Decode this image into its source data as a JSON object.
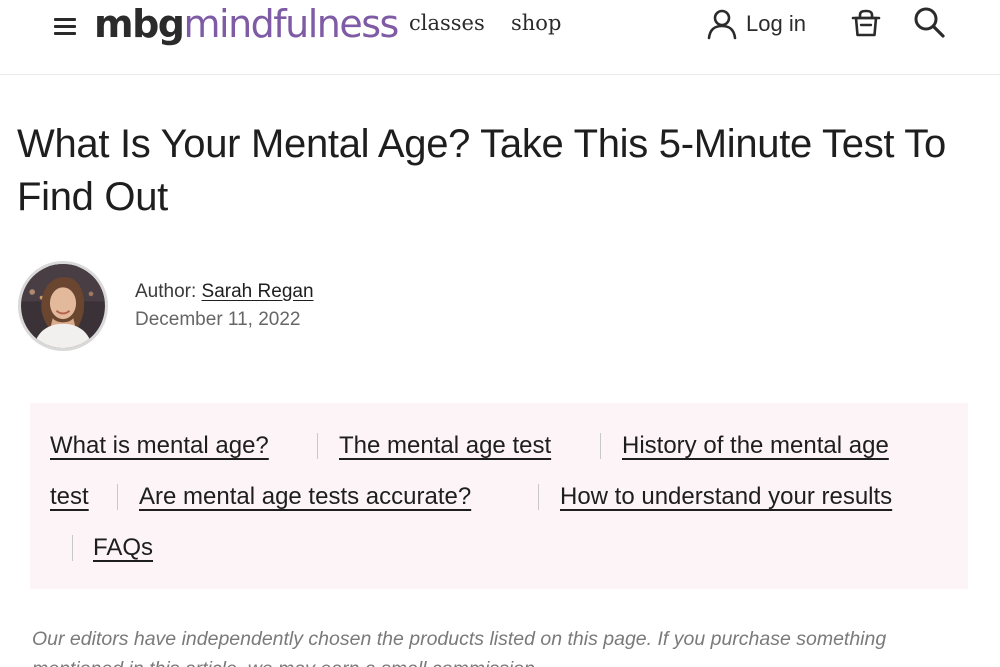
{
  "header": {
    "logo_prefix": "mbg",
    "logo_suffix": "mindfulness",
    "nav": [
      {
        "label": "classes"
      },
      {
        "label": "shop"
      }
    ],
    "login_label": "Log in",
    "colors": {
      "logo_accent": "#7f5ba6",
      "text": "#2b2b2b"
    }
  },
  "article": {
    "title": "What Is Your Mental Age? Take This 5-Minute Test To Find Out",
    "author_prefix": "Author:",
    "author_name": "Sarah Regan",
    "date": "December 11, 2022"
  },
  "toc": {
    "background": "#fcf4f6",
    "items": [
      {
        "label": "What is mental age?"
      },
      {
        "label": "The mental age test"
      },
      {
        "label": "History of the mental age"
      },
      {
        "label": "test"
      },
      {
        "label": "Are mental age tests accurate?"
      },
      {
        "label": "How to understand your results"
      },
      {
        "label": "FAQs"
      }
    ]
  },
  "disclaimer": "Our editors have independently chosen the products listed on this page. If you purchase something mentioned in this article, we may earn a small commission."
}
